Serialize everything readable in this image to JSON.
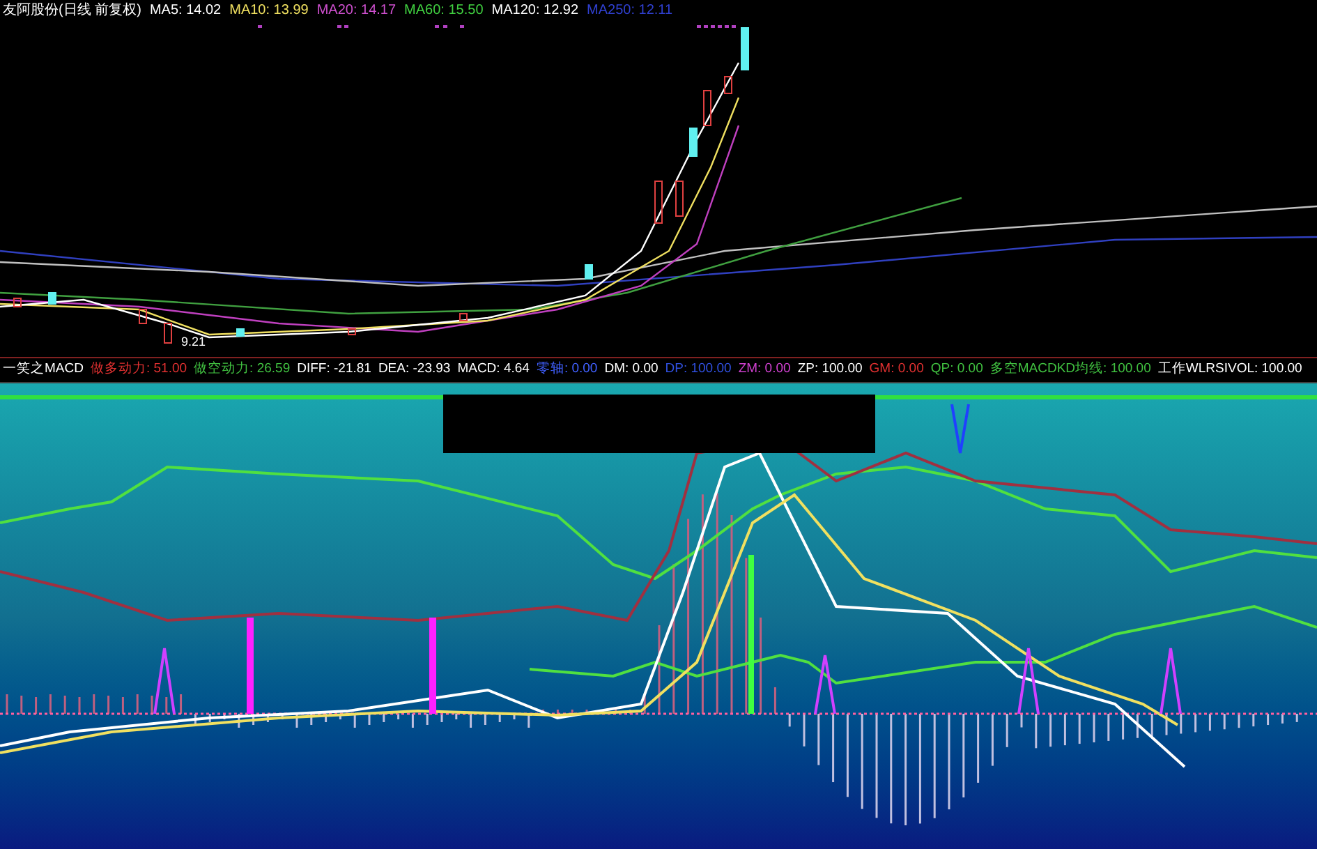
{
  "price_panel": {
    "title": "友阿股份(日线 前复权)",
    "indicators": [
      {
        "label": "MA5: 14.02",
        "color": "#ffffff"
      },
      {
        "label": "MA10: 13.99",
        "color": "#f0e060"
      },
      {
        "label": "MA20: 14.17",
        "color": "#d050d0"
      },
      {
        "label": "MA60: 15.50",
        "color": "#40d040"
      },
      {
        "label": "MA120: 12.92",
        "color": "#ffffff"
      },
      {
        "label": "MA250: 12.11",
        "color": "#3040d0"
      }
    ],
    "low_marker": "9.21"
  },
  "indicator_panel": {
    "name": "一笑之MACD",
    "readings": [
      {
        "label": "做多动力:",
        "value": "51.00",
        "color": "#e03030"
      },
      {
        "label": "做空动力:",
        "value": "26.59",
        "color": "#40c040"
      },
      {
        "label": "DIFF:",
        "value": "-21.81",
        "color": "#ffffff"
      },
      {
        "label": "DEA:",
        "value": "-23.93",
        "color": "#ffffff"
      },
      {
        "label": "MACD:",
        "value": "4.64",
        "color": "#ffffff"
      },
      {
        "label": "零轴:",
        "value": "0.00",
        "color": "#4060ff"
      },
      {
        "label": "DM:",
        "value": "0.00",
        "color": "#ffffff"
      },
      {
        "label": "DP:",
        "value": "100.00",
        "color": "#3050e0"
      },
      {
        "label": "ZM:",
        "value": "0.00",
        "color": "#d040d0"
      },
      {
        "label": "ZP:",
        "value": "100.00",
        "color": "#ffffff"
      },
      {
        "label": "GM:",
        "value": "0.00",
        "color": "#e03030"
      },
      {
        "label": "QP:",
        "value": "0.00",
        "color": "#40c040"
      },
      {
        "label": "多空MACDKD均线:",
        "value": "100.00",
        "color": "#40c040"
      },
      {
        "label": "工作WLRSIVOL:",
        "value": "100.00",
        "color": "#ffffff"
      }
    ]
  }
}
